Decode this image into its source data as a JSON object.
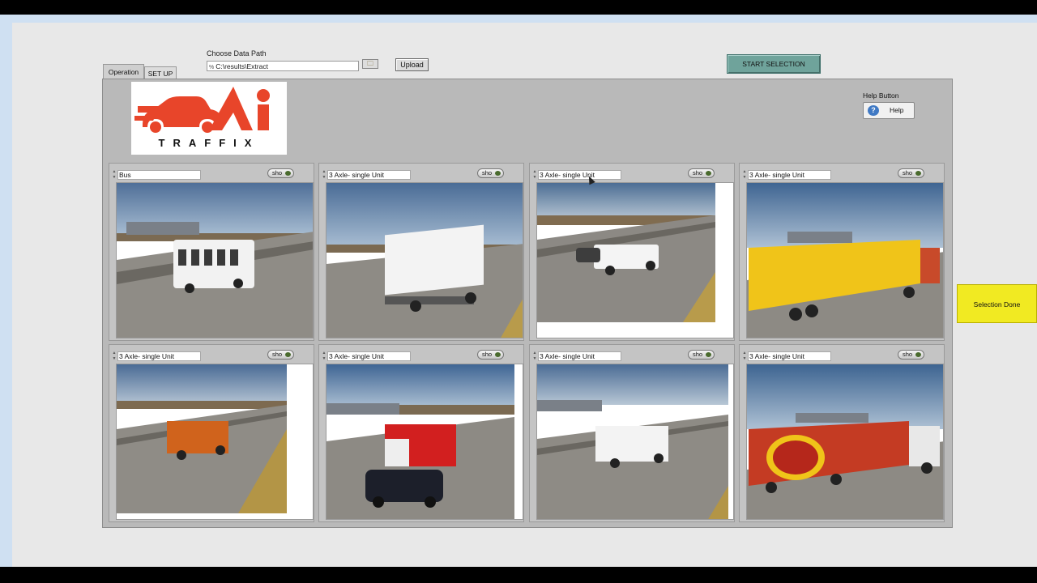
{
  "header": {
    "path_label": "Choose  Data Path",
    "path_value": "C:\\results\\Extract",
    "upload_label": "Upload",
    "start_label": "START SELECTION"
  },
  "tabs": [
    {
      "label": "Operation"
    },
    {
      "label": "SET UP"
    }
  ],
  "logo": {
    "brand_text": "TRAFFIX"
  },
  "help": {
    "label": "Help Button",
    "button_label": "Help"
  },
  "grid": {
    "show_label": "sho",
    "cells": [
      {
        "class": "Bus"
      },
      {
        "class": "3 Axle- single Unit"
      },
      {
        "class": "3 Axle- single Unit"
      },
      {
        "class": "3 Axle- single Unit"
      },
      {
        "class": "3 Axle- single Unit"
      },
      {
        "class": "3 Axle- single Unit"
      },
      {
        "class": "3 Axle- single Unit"
      },
      {
        "class": "3 Axle- single Unit"
      }
    ]
  },
  "selection_done_label": "Selection Done",
  "colors": {
    "logo_red": "#e8452a",
    "start_button": "#6fa39b",
    "selection_done": "#f1ea22"
  }
}
